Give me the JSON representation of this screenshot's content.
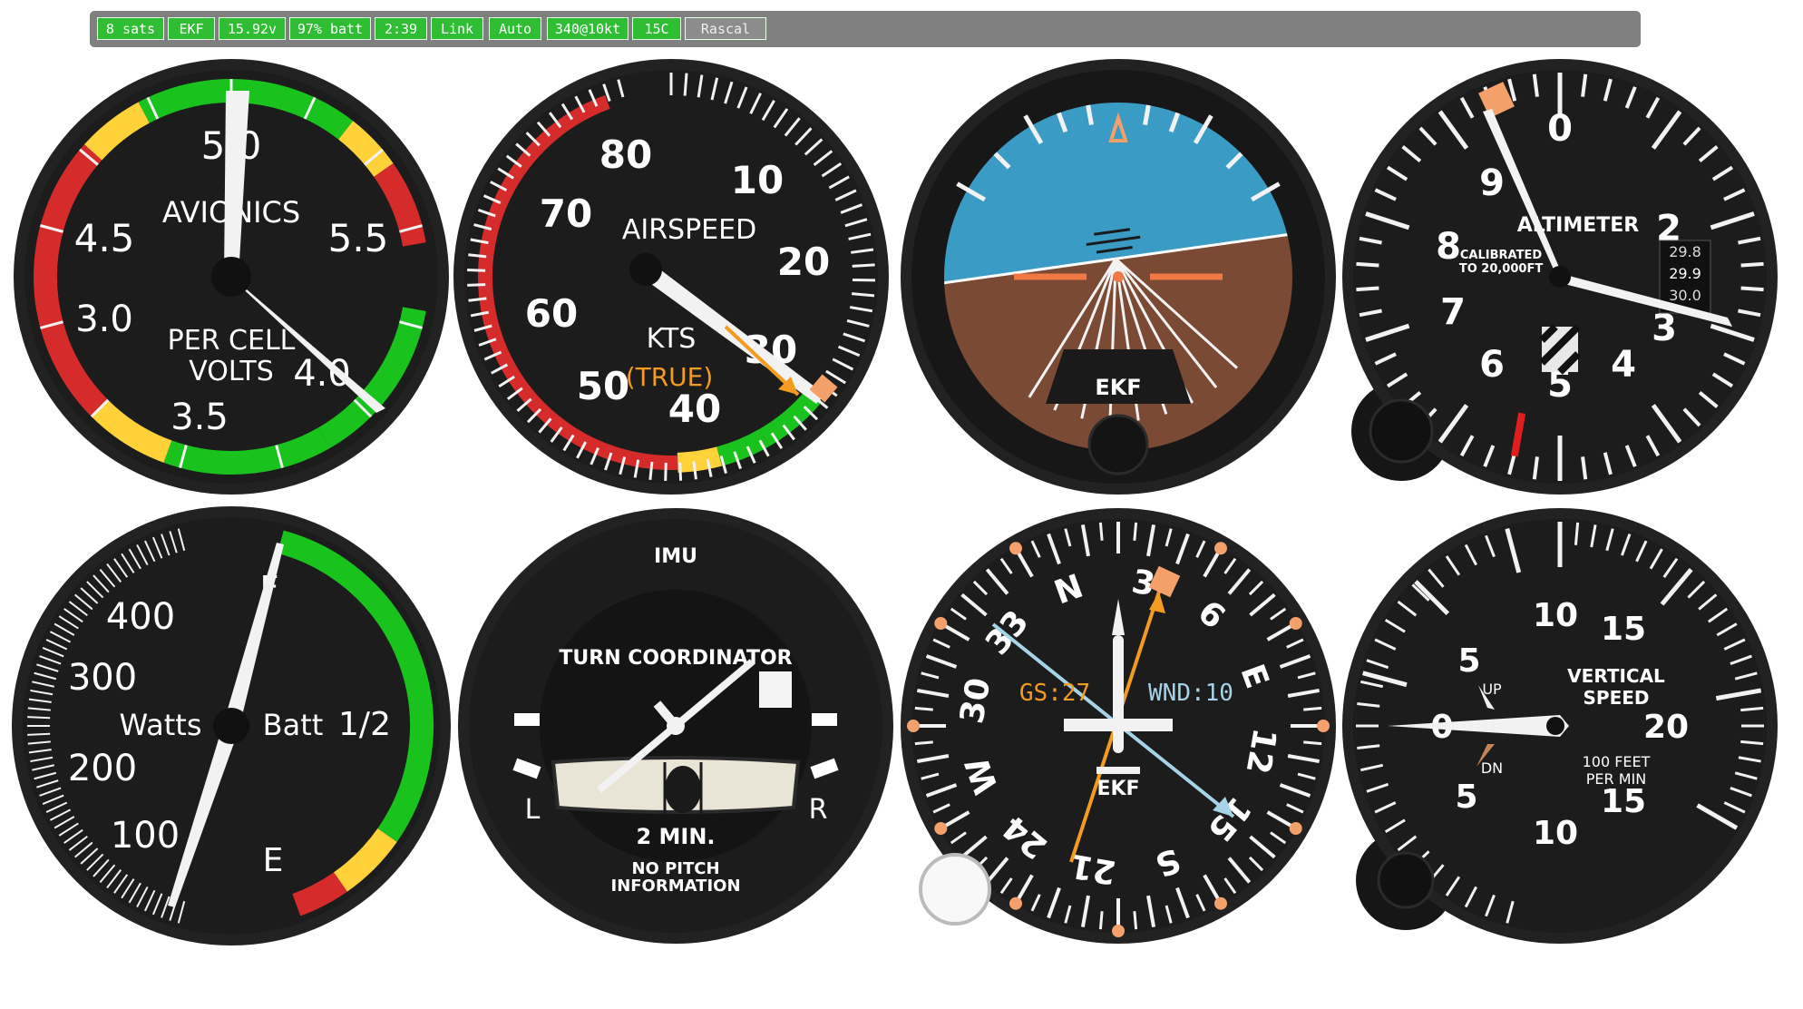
{
  "statusbar": {
    "items": [
      {
        "label": "8 sats",
        "state": "ok"
      },
      {
        "label": "EKF",
        "state": "ok"
      },
      {
        "label": "15.92v",
        "state": "ok"
      },
      {
        "label": "97% batt",
        "state": "ok"
      },
      {
        "label": "2:39",
        "state": "ok"
      },
      {
        "label": "Link",
        "state": "ok"
      },
      {
        "label": "Auto",
        "state": "ok"
      },
      {
        "label": "340@10kt",
        "state": "ok"
      },
      {
        "label": "15C",
        "state": "ok"
      },
      {
        "label": "Rascal",
        "state": "inactive"
      }
    ]
  },
  "colors": {
    "ok": "#2fbd34",
    "inactive": "#8c8c8c",
    "sky": "#3a9cc4",
    "ground": "#7b4a35",
    "caution": "#ffd23a",
    "warning": "#d62b2b",
    "normal": "#19c21d",
    "bug": "#f4a06b",
    "orange": "#f39c1f",
    "wind_vector": "#a6d3e8"
  },
  "gauges": {
    "avionics": {
      "scale_labels": [
        "4.5",
        "5.0",
        "5.5"
      ],
      "title": "AVIONICS",
      "cell_scale_labels": [
        "3.0",
        "3.5",
        "4.0"
      ],
      "cell_title_line1": "PER CELL",
      "cell_title_line2": "VOLTS"
    },
    "airspeed": {
      "scale_labels": [
        "80",
        "10",
        "70",
        "20",
        "60",
        "50",
        "40",
        "30"
      ],
      "title": "AIRSPEED",
      "units": "KTS",
      "subtitle": "(TRUE)"
    },
    "attitude": {
      "source": "EKF"
    },
    "altimeter": {
      "digits": [
        "0",
        "2",
        "3",
        "4",
        "5",
        "6",
        "7",
        "8",
        "9"
      ],
      "title": "ALTIMETER",
      "calibration_line1": "CALIBRATED",
      "calibration_line2": "TO 20,000FT",
      "baro": [
        "29.8",
        "29.9",
        "30.0"
      ]
    },
    "power": {
      "scale_labels": [
        "400",
        "300",
        "200",
        "100"
      ],
      "watts_label": "Watts",
      "batt_label": "Batt",
      "half_label": "1/2",
      "full_label": "F",
      "empty_label": "E"
    },
    "turn_coordinator": {
      "source": "IMU",
      "title": "TURN COORDINATOR",
      "left_label": "L",
      "right_label": "R",
      "time_label": "2 MIN.",
      "note_line1": "NO PITCH",
      "note_line2": "INFORMATION"
    },
    "heading": {
      "cardinals": [
        "N",
        "E",
        "S",
        "W"
      ],
      "numbers": [
        "3",
        "6",
        "12",
        "15",
        "21",
        "24",
        "30",
        "33"
      ],
      "ground_speed": "GS:27",
      "wind": "WND:10",
      "source": "EKF"
    },
    "vsi": {
      "scale_up": [
        "5",
        "10",
        "15",
        "20"
      ],
      "scale_down": [
        "5",
        "10",
        "15"
      ],
      "zero": "0",
      "up_label": "UP",
      "down_label": "DN",
      "title_line1": "VERTICAL",
      "title_line2": "SPEED",
      "units_line1": "100 FEET",
      "units_line2": "PER MIN"
    }
  }
}
